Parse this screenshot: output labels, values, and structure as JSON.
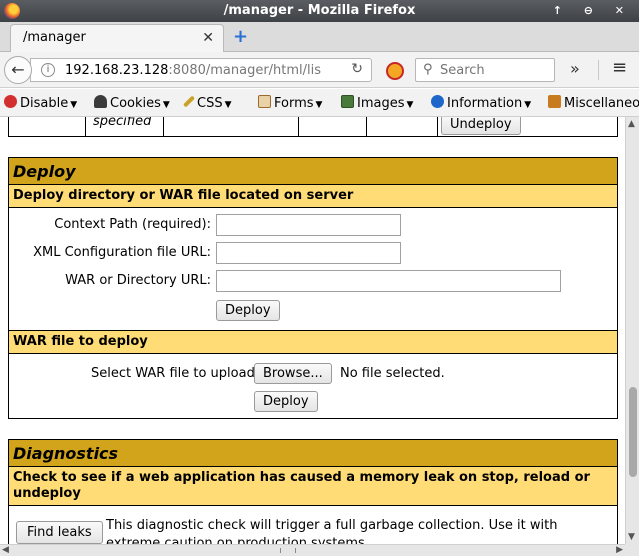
{
  "window": {
    "title": "/manager - Mozilla Firefox",
    "controls": "↑ ⊖ ✕"
  },
  "tabs": [
    {
      "title": "/manager",
      "close": "✕"
    }
  ],
  "newtab": "+",
  "nav": {
    "back": "←",
    "url_host": "192.168.23.128",
    "url_rest": ":8080/manager/html/lis",
    "reload": "↻",
    "search_placeholder": "Search",
    "overflow": "»",
    "menu": "≡"
  },
  "devtoolbar": {
    "items": [
      {
        "label": "Disable",
        "icon": "disable-icon",
        "color": "#d32f2f"
      },
      {
        "label": "Cookies",
        "icon": "cookies-icon",
        "color": "#3b3b3b"
      },
      {
        "label": "CSS",
        "icon": "css-icon",
        "color": "#c9a227"
      },
      {
        "label": "Forms",
        "icon": "forms-icon",
        "color": "#9b6a2f"
      },
      {
        "label": "Images",
        "icon": "images-icon",
        "color": "#4a7a3a"
      },
      {
        "label": "Information",
        "icon": "information-icon",
        "color": "#1e66c9"
      },
      {
        "label": "Miscellaneo",
        "icon": "miscellaneous-icon",
        "color": "#c77b1e"
      }
    ]
  },
  "prev_row": {
    "specified": "specified",
    "undeploy": "Undeploy"
  },
  "deploy": {
    "title": "Deploy",
    "server_heading": "Deploy directory or WAR file located on server",
    "context_label": "Context Path (required):",
    "context_value": "",
    "xml_label": "XML Configuration file URL:",
    "xml_value": "",
    "war_label": "WAR or Directory URL:",
    "war_value": "",
    "deploy_button": "Deploy",
    "upload_heading": "WAR file to deploy",
    "select_label": "Select WAR file to upload",
    "browse_button": "Browse...",
    "no_file": "No file selected.",
    "upload_deploy_button": "Deploy"
  },
  "diagnostics": {
    "title": "Diagnostics",
    "leak_heading": "Check to see if a web application has caused a memory leak on stop, reload or undeploy",
    "find_leaks_button": "Find leaks",
    "description": "This diagnostic check will trigger a full garbage collection. Use it with extreme caution on production systems."
  },
  "colors": {
    "section_header": "#d2a41c",
    "sub_header": "#ffdc75"
  }
}
